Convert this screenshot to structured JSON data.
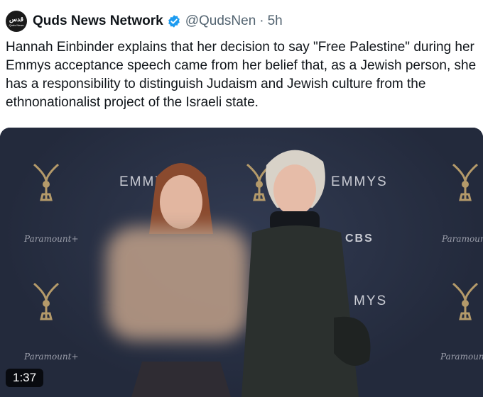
{
  "post": {
    "avatar_text": "قدس",
    "avatar_sub": "Quds News",
    "author_name": "Quds News Network",
    "handle": "@QudsNen",
    "separator": "·",
    "time": "5h",
    "text": "Hannah Einbinder explains that her decision to say \"Free Palestine\" during her Emmys acceptance speech came from her belief that, as a Jewish person, she has a responsibility to distinguish Judaism and Jewish culture from the ethnonationalist project of the Israeli state."
  },
  "video": {
    "duration": "1:37",
    "backdrop_labels": {
      "emmys_1": "EMMY",
      "emmys_2": "EMMYS",
      "emmys_3": "MYS",
      "cbs": "CBS",
      "paramount_1": "Paramount+",
      "paramount_2": "Paramount",
      "paramount_3": "Paramount+",
      "paramount_4": "Paramount"
    }
  },
  "colors": {
    "verified": "#1d9bf0",
    "backdrop": "#262d40"
  },
  "icons": {
    "verified": "verified-badge-icon"
  }
}
